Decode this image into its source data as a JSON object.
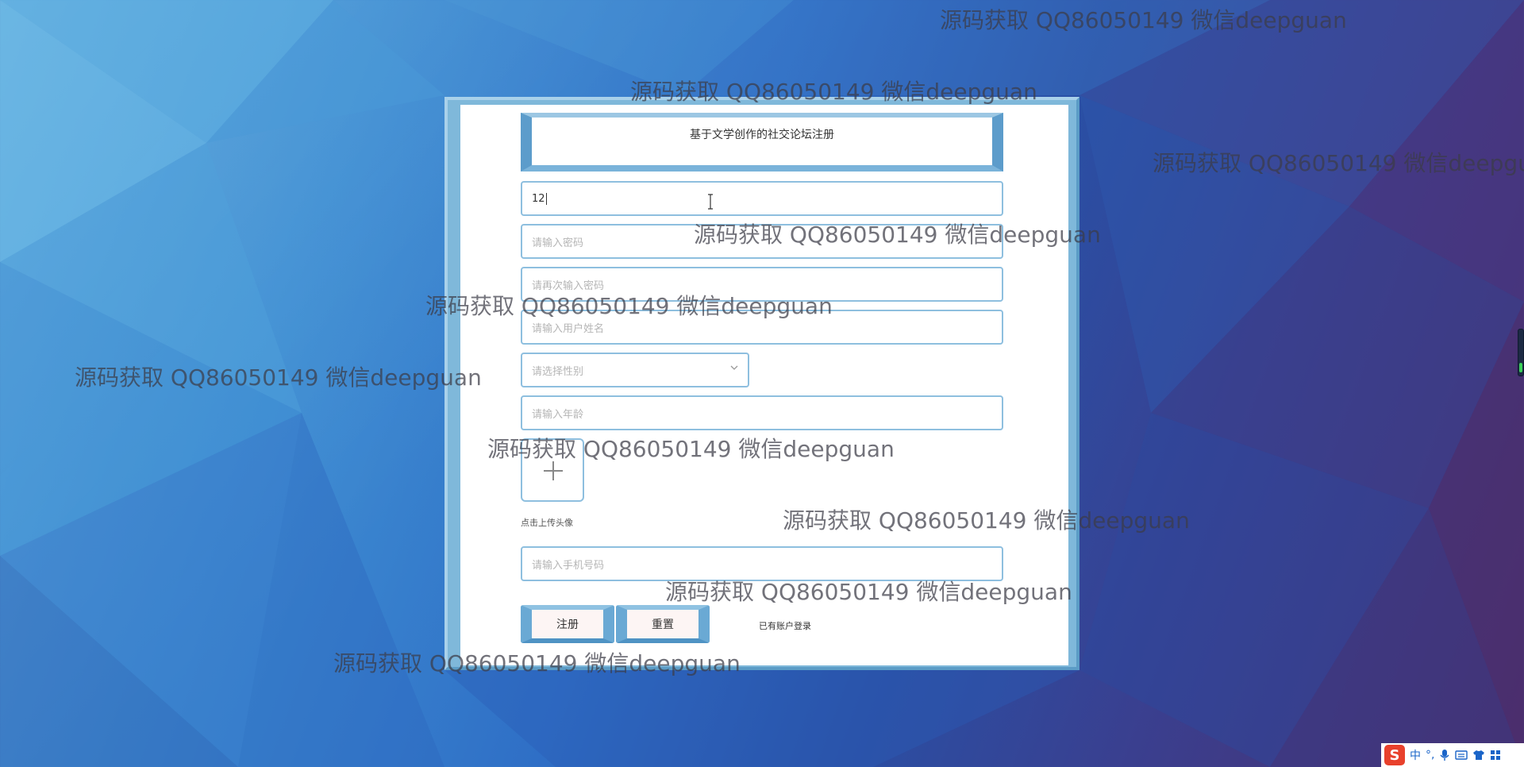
{
  "form": {
    "title": "基于文学创作的社交论坛注册",
    "username_value": "12",
    "password_placeholder": "请输入密码",
    "confirm_password_placeholder": "请再次输入密码",
    "name_placeholder": "请输入用户姓名",
    "gender_placeholder": "请选择性别",
    "age_placeholder": "请输入年龄",
    "avatar_label": "点击上传头像",
    "phone_placeholder": "请输入手机号码",
    "register_label": "注册",
    "reset_label": "重置",
    "login_link": "已有账户登录"
  },
  "watermark_text": "源码获取 QQ86050149 微信deepguan",
  "ime": {
    "logo": "S",
    "mode": "中",
    "punct": "°,",
    "icons": [
      "mic-icon",
      "keyboard-icon",
      "shirt-icon",
      "grid-icon"
    ]
  },
  "colors": {
    "card_frame": "#7fb8da",
    "input_border": "#8ebfdf",
    "button_fill": "#fdf5f4",
    "watermark": "#3c3c46"
  }
}
